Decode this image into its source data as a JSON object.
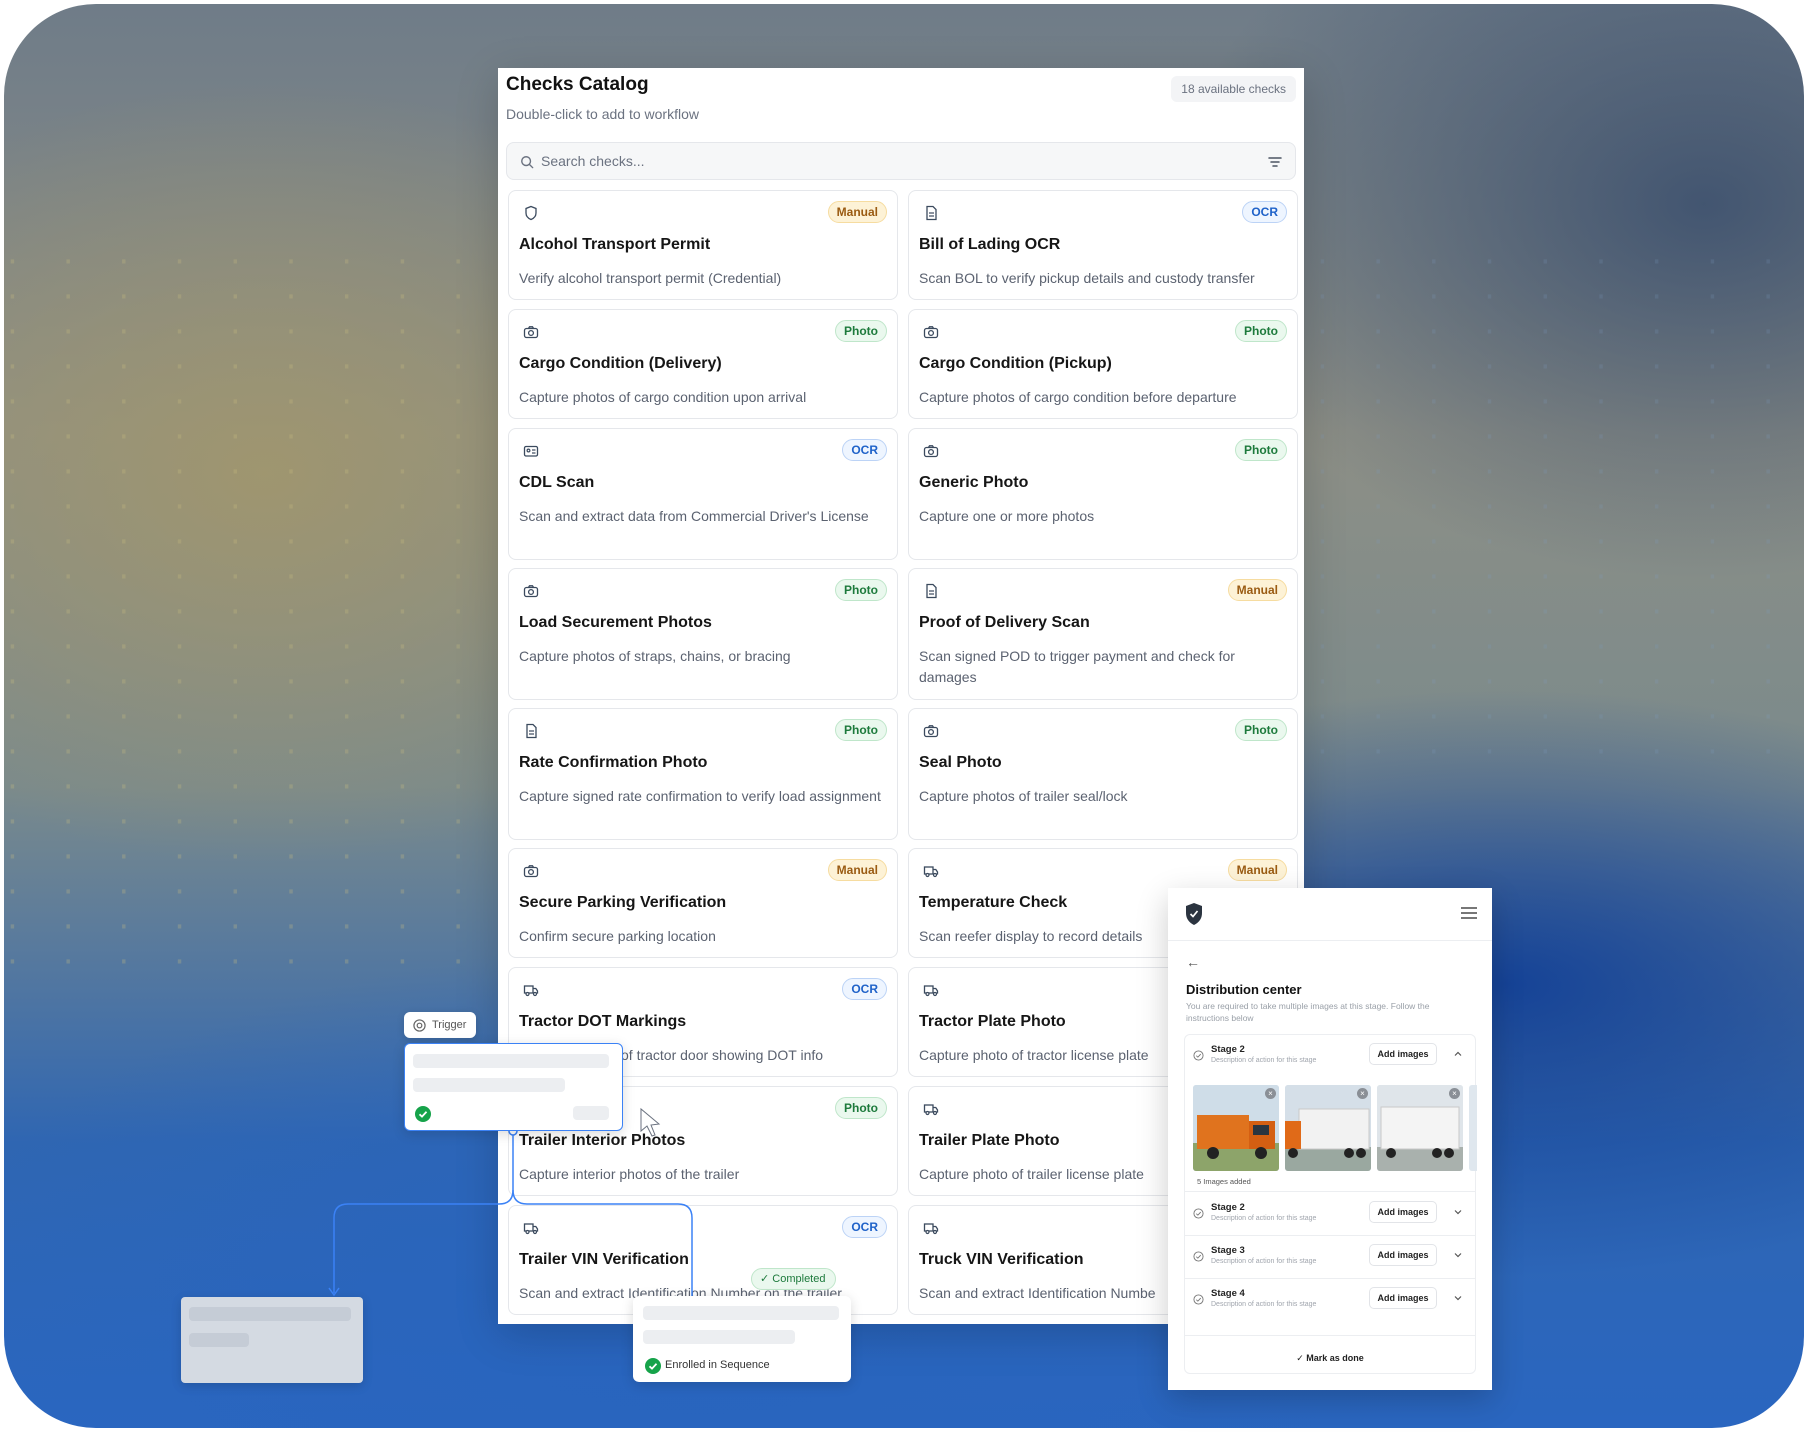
{
  "catalog": {
    "title": "Checks Catalog",
    "subtitle": "Double-click to add to workflow",
    "count_label": "18 available checks",
    "search_placeholder": "Search checks...",
    "cards": [
      {
        "icon": "shield-icon",
        "badge": "Manual",
        "badge_type": "manual",
        "title": "Alcohol Transport Permit",
        "desc": "Verify alcohol transport permit (Credential)"
      },
      {
        "icon": "document-icon",
        "badge": "OCR",
        "badge_type": "ocr",
        "title": "Bill of Lading OCR",
        "desc": "Scan BOL to verify pickup details and custody transfer"
      },
      {
        "icon": "camera-icon",
        "badge": "Photo",
        "badge_type": "photo",
        "title": "Cargo Condition (Delivery)",
        "desc": "Capture photos of cargo condition upon arrival"
      },
      {
        "icon": "camera-icon",
        "badge": "Photo",
        "badge_type": "photo",
        "title": "Cargo Condition (Pickup)",
        "desc": "Capture photos of cargo condition before departure"
      },
      {
        "icon": "id-card-icon",
        "badge": "OCR",
        "badge_type": "ocr",
        "title": "CDL Scan",
        "desc": "Scan and extract data from Commercial Driver's License"
      },
      {
        "icon": "camera-icon",
        "badge": "Photo",
        "badge_type": "photo",
        "title": "Generic Photo",
        "desc": "Capture one or more photos"
      },
      {
        "icon": "camera-icon",
        "badge": "Photo",
        "badge_type": "photo",
        "title": "Load Securement Photos",
        "desc": "Capture photos of straps, chains, or bracing"
      },
      {
        "icon": "document-icon",
        "badge": "Manual",
        "badge_type": "manual",
        "title": "Proof of Delivery Scan",
        "desc": "Scan signed POD to trigger payment and check for damages"
      },
      {
        "icon": "document-icon",
        "badge": "Photo",
        "badge_type": "photo",
        "title": "Rate Confirmation Photo",
        "desc": "Capture signed rate confirmation to verify load assignment"
      },
      {
        "icon": "camera-icon",
        "badge": "Photo",
        "badge_type": "photo",
        "title": "Seal Photo",
        "desc": "Capture photos of trailer seal/lock"
      },
      {
        "icon": "camera-icon",
        "badge": "Manual",
        "badge_type": "manual",
        "title": "Secure Parking Verification",
        "desc": "Confirm secure parking location"
      },
      {
        "icon": "truck-icon",
        "badge": "Manual",
        "badge_type": "manual",
        "title": "Temperature Check",
        "desc": "Scan reefer display to record details"
      },
      {
        "icon": "truck-icon",
        "badge": "OCR",
        "badge_type": "ocr",
        "title": "Tractor DOT Markings",
        "desc": "of tractor door showing DOT info"
      },
      {
        "icon": "truck-icon",
        "badge": "",
        "badge_type": "",
        "title": "Tractor Plate Photo",
        "desc": "Capture photo of tractor license plate"
      },
      {
        "icon": "",
        "badge": "Photo",
        "badge_type": "photo",
        "title": "Trailer Interior Photos",
        "desc": "Capture interior photos of the trailer"
      },
      {
        "icon": "truck-icon",
        "badge": "",
        "badge_type": "",
        "title": "Trailer Plate Photo",
        "desc": "Capture photo of trailer license plate"
      },
      {
        "icon": "truck-icon",
        "badge": "OCR",
        "badge_type": "ocr",
        "title": "Trailer VIN Verification",
        "desc": "Scan and extract Identification Number on the trailer"
      },
      {
        "icon": "truck-icon",
        "badge": "",
        "badge_type": "",
        "title": "Truck VIN Verification",
        "desc": "Scan and extract Identification Numbe"
      }
    ]
  },
  "mobile": {
    "back": "←",
    "title": "Distribution center",
    "subtitle": "You are required to take multiple images at this stage. Follow the instructions below",
    "stages": [
      {
        "name": "Stage 2",
        "desc": "Description of action for this stage",
        "button": "Add images",
        "expanded": true
      },
      {
        "name": "Stage 2",
        "desc": "Description of action for this stage",
        "button": "Add images",
        "expanded": false
      },
      {
        "name": "Stage 3",
        "desc": "Description of action for this stage",
        "button": "Add images",
        "expanded": false
      },
      {
        "name": "Stage 4",
        "desc": "Description of action for this stage",
        "button": "Add images",
        "expanded": false
      }
    ],
    "images_added": "5 Images added",
    "mark_done": "Mark as done"
  },
  "flow": {
    "trigger_label": "Trigger",
    "completed_label": "Completed",
    "enrolled_label": "Enrolled in Sequence"
  },
  "colors": {
    "manual_badge": "#9a5b12",
    "ocr_badge": "#1f62c9",
    "photo_badge": "#1d7a3c",
    "flow_line": "#3b82f6",
    "success": "#16a34a"
  }
}
